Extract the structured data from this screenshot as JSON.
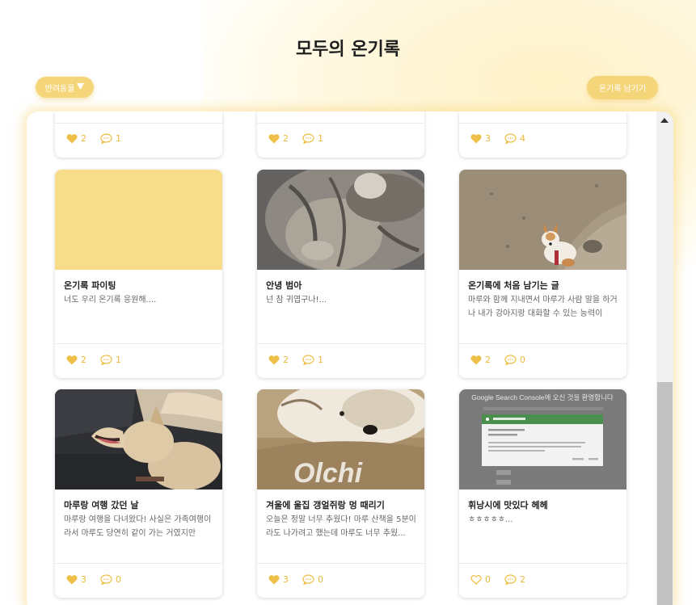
{
  "header": {
    "title": "모두의 온기록",
    "filter_label": "반려동물",
    "write_label": "온기록 남기기"
  },
  "colors": {
    "accent": "#f5d57a",
    "heart": "#eec04a",
    "stat_text": "#e9b93a"
  },
  "cards_top": [
    {
      "likes": "2",
      "comments": "1"
    },
    {
      "likes": "2",
      "comments": "1"
    },
    {
      "likes": "3",
      "comments": "4"
    }
  ],
  "cards": [
    {
      "title": "온기록 파이팅",
      "body": "너도 우리 온기록 응원해....",
      "likes": "2",
      "comments": "1",
      "liked": true,
      "image": "yellow-placeholder"
    },
    {
      "title": "안녕 범아",
      "body": "넌 참 귀엽구나!...",
      "likes": "2",
      "comments": "1",
      "liked": true,
      "image": "cat-photo"
    },
    {
      "title": "온기록에 처음 남기는 글",
      "body": "마루와 함께 지내면서 마루가 사람 말을 하거나 내가 강아지랑 대화할 수 있는 능력이",
      "likes": "2",
      "comments": "0",
      "liked": true,
      "image": "dog-on-sand-photo"
    },
    {
      "title": "마루랑 여행 갔던 날",
      "body": "마루랑 여행을 다녀왔다! 사실은 가족여행이라서 마루도 당연히 같이 가는 거였지만",
      "likes": "3",
      "comments": "0",
      "liked": true,
      "image": "dog-in-car-photo"
    },
    {
      "title": "겨울에 울집 갱얼쥐랑 멍 때리기",
      "body": "오늘은 정말 너무 추웠다! 마루 산책을 5분이라도 나가려고 했는데 마루도 너무 추웠...",
      "likes": "3",
      "comments": "0",
      "liked": true,
      "image": "dog-cushion-photo",
      "image_text": "Olchi"
    },
    {
      "title": "휘낭시에 맛있다 헤헤",
      "body": "ㅎㅎㅎㅎㅎ...",
      "likes": "0",
      "comments": "2",
      "liked": false,
      "image": "search-console-screenshot",
      "image_text": "Google Search Console에 오신 것을 환영합니다"
    }
  ]
}
